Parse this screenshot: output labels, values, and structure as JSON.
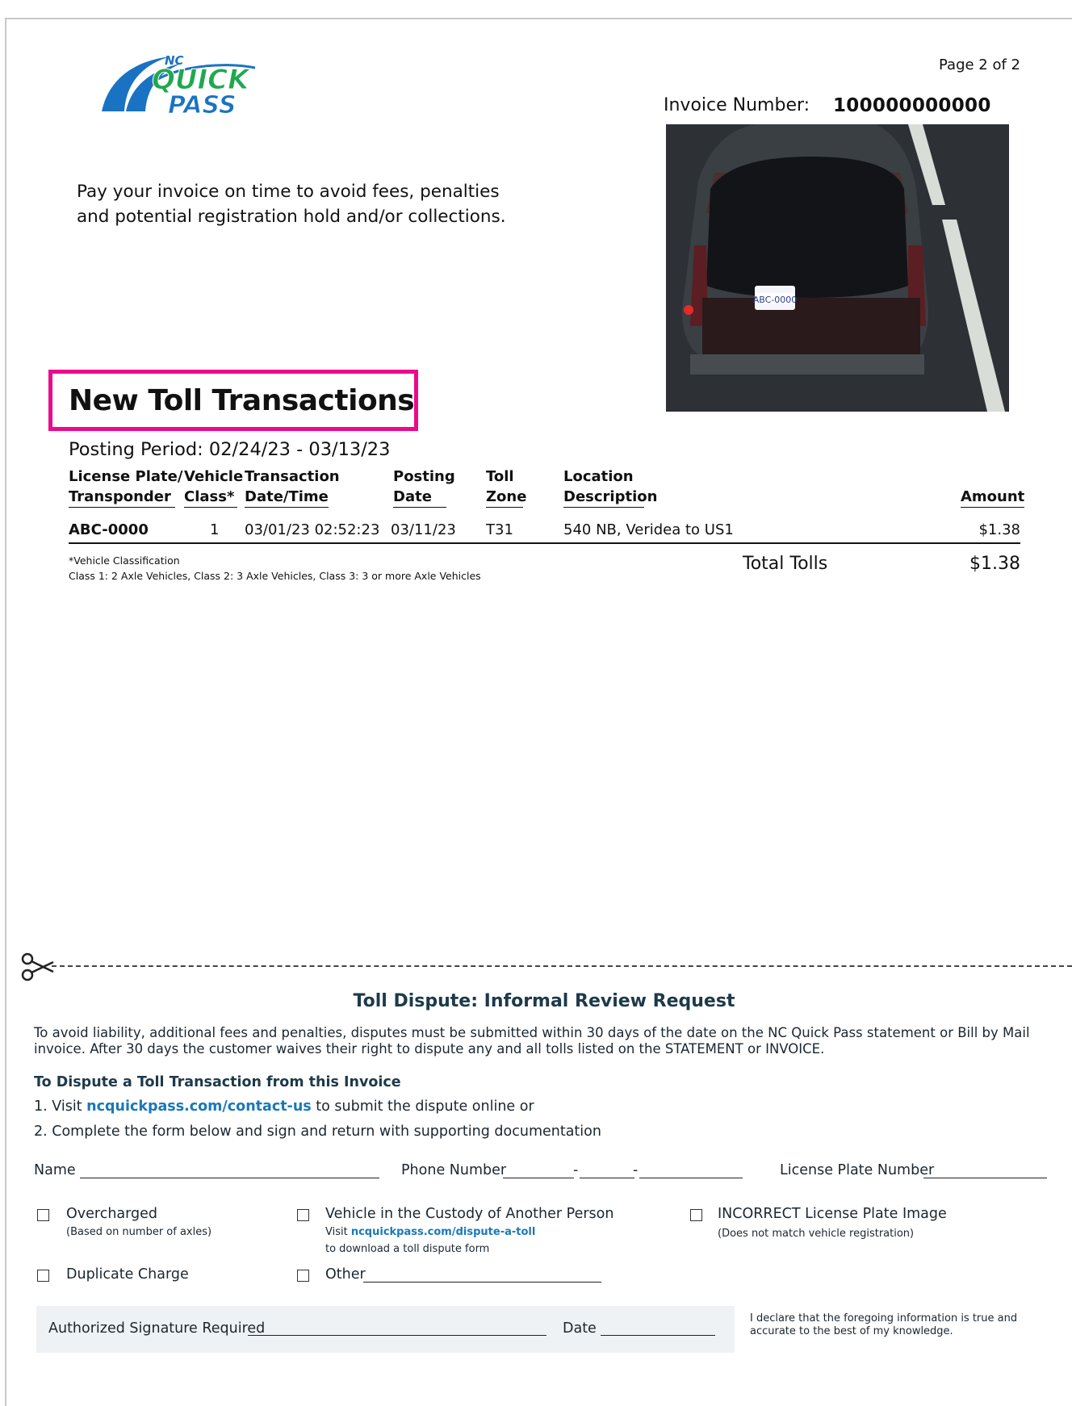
{
  "header": {
    "logo_small": "NC",
    "logo_main": "QUICK",
    "logo_sub": "PASS",
    "page_number": "Page 2 of 2",
    "invoice_label": "Invoice Number:",
    "invoice_number": "100000000000"
  },
  "photo": {
    "plate_text": "ABC-0000"
  },
  "notice": {
    "line1": "Pay your invoice on time to avoid fees, penalties",
    "line2": "and potential registration hold and/or collections."
  },
  "transactions": {
    "title": "New Toll Transactions",
    "posting_period": "Posting Period: 02/24/23 - 03/13/23",
    "columns": {
      "plate_l1": "License Plate/",
      "plate_l2": "Transponder",
      "class_l1": "Vehicle",
      "class_l2": "Class*",
      "datetime_l1": "Transaction",
      "datetime_l2": "Date/Time",
      "posting_l1": "Posting",
      "posting_l2": "Date",
      "zone_l1": "Toll",
      "zone_l2": "Zone",
      "location_l1": "Location",
      "location_l2": "Description",
      "amount": "Amount"
    },
    "rows": [
      {
        "plate": "ABC-0000",
        "vehicle_class": "1",
        "datetime": "03/01/23 02:52:23",
        "posting_date": "03/11/23",
        "zone": "T31",
        "location": "540 NB, Veridea to US1",
        "amount": "$1.38"
      }
    ],
    "footnote_l1": "*Vehicle Classification",
    "footnote_l2": "Class 1: 2 Axle Vehicles,  Class 2: 3 Axle Vehicles,  Class 3: 3 or more Axle Vehicles",
    "total_label": "Total Tolls",
    "total_value": "$1.38"
  },
  "dispute": {
    "title": "Toll Dispute: Informal Review Request",
    "intro": "To avoid liability, additional fees and penalties, disputes must be submitted within 30 days of the date on the NC Quick Pass statement or Bill by Mail invoice. After 30 days the customer waives their right to dispute any and all tolls listed on the STATEMENT or INVOICE.",
    "subhead": "To Dispute a Toll Transaction from this Invoice",
    "step1_prefix": "1.  Visit ",
    "step1_link": "ncquickpass.com/contact-us",
    "step1_suffix": " to submit the dispute online or",
    "step2": "2.  Complete the form below and sign and return with supporting documentation",
    "fields": {
      "name": "Name",
      "phone": "Phone Number",
      "phone_sep": "-",
      "plate": "License Plate Number"
    },
    "options": {
      "overcharged": "Overcharged",
      "overcharged_sub": "(Based on  number of axles)",
      "custody": "Vehicle in the Custody of Another Person",
      "custody_sub_prefix": "Visit ",
      "custody_sub_link": "ncquickpass.com/dispute-a-toll",
      "custody_sub2": "to download a toll dispute form",
      "incorrect": "INCORRECT License Plate Image",
      "incorrect_sub": "(Does not match vehicle registration)",
      "duplicate": "Duplicate Charge",
      "other": "Other"
    },
    "signature_label": "Authorized Signature Required",
    "date_label": "Date",
    "declaration": "I declare that the foregoing information is true and accurate to the best of my knowledge."
  },
  "colors": {
    "highlight_box": "#ec0a8c",
    "logo_blue": "#1a73c2",
    "logo_green": "#1fa84f",
    "link": "#1a78b8"
  }
}
